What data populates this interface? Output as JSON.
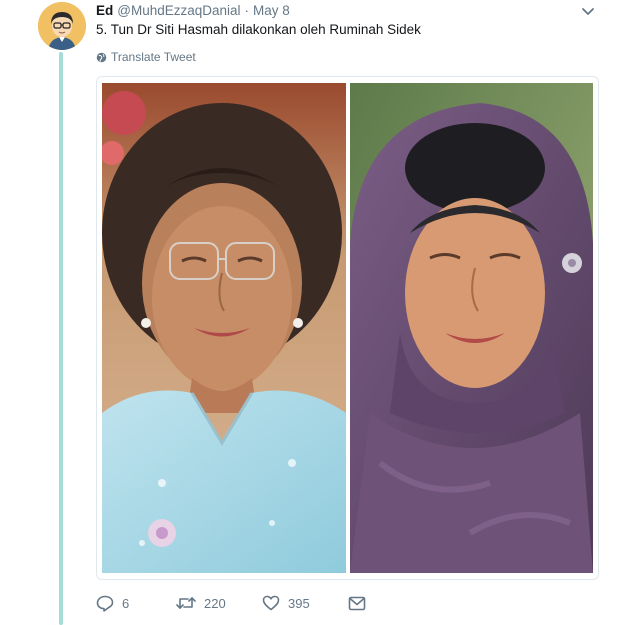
{
  "tweet": {
    "author_name": "Ed",
    "handle": "@MuhdEzzaqDanial",
    "separator": "·",
    "date": "May 8",
    "text": "5. Tun Dr Siti Hasmah dilakonkan oleh Ruminah Sidek",
    "translate_label": "Translate Tweet"
  },
  "actions": {
    "reply_count": "6",
    "retweet_count": "220",
    "like_count": "395"
  },
  "icons": {
    "avatar": "cartoon-avatar",
    "more": "chevron-down-icon",
    "translate": "globe-icon",
    "reply": "reply-icon",
    "retweet": "retweet-icon",
    "like": "heart-icon",
    "dm": "envelope-icon"
  },
  "colors": {
    "thread_line": "#a5dcd6",
    "muted_text": "#657786",
    "primary_text": "#14171a",
    "avatar_bg": "#f0c063"
  }
}
